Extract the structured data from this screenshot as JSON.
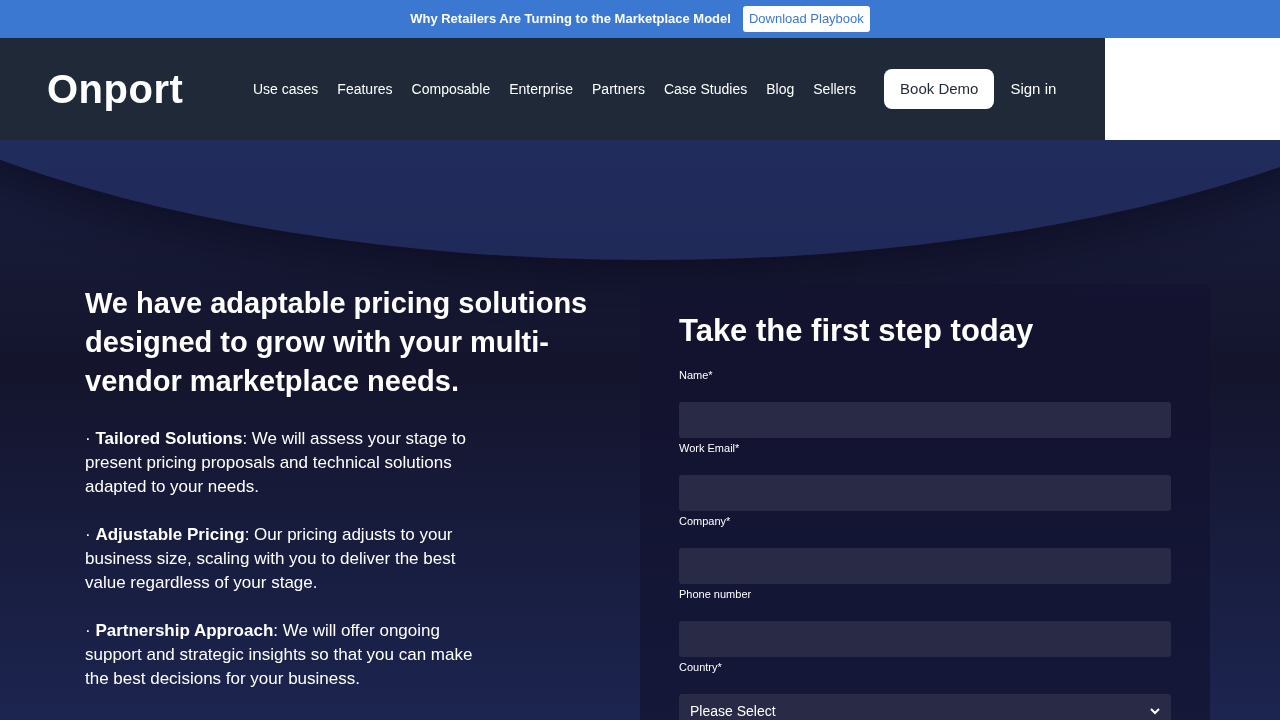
{
  "announcement": {
    "text": "Why Retailers Are Turning to the Marketplace Model",
    "button": "Download Playbook"
  },
  "header": {
    "logo": "Onport",
    "nav": [
      "Use cases",
      "Features",
      "Composable",
      "Enterprise",
      "Partners",
      "Case Studies",
      "Blog",
      "Sellers"
    ],
    "cta": "Book Demo",
    "sign_in": "Sign in"
  },
  "hero": {
    "heading": "We have adaptable pricing solutions designed to grow with your multi-vendor marketplace needs.",
    "points": [
      "· **Tailored Solutions**: We will assess your stage to present pricing proposals and technical solutions adapted to your needs.",
      "· **Adjustable Pricing**: Our pricing adjusts to your business size, scaling with you to deliver the best value regardless of your stage.",
      "· **Partnership Approach**: We will offer ongoing support and strategic insights so that you can make the best decisions for your business."
    ]
  },
  "form": {
    "title": "Take the first step today",
    "fields": [
      {
        "kind": "text",
        "label": "Name*"
      },
      {
        "kind": "text",
        "label": "Work Email*"
      },
      {
        "kind": "text",
        "label": "Company*"
      },
      {
        "kind": "text",
        "label": "Phone number"
      },
      {
        "kind": "select",
        "label": "Country*",
        "value": "Please Select"
      }
    ]
  }
}
